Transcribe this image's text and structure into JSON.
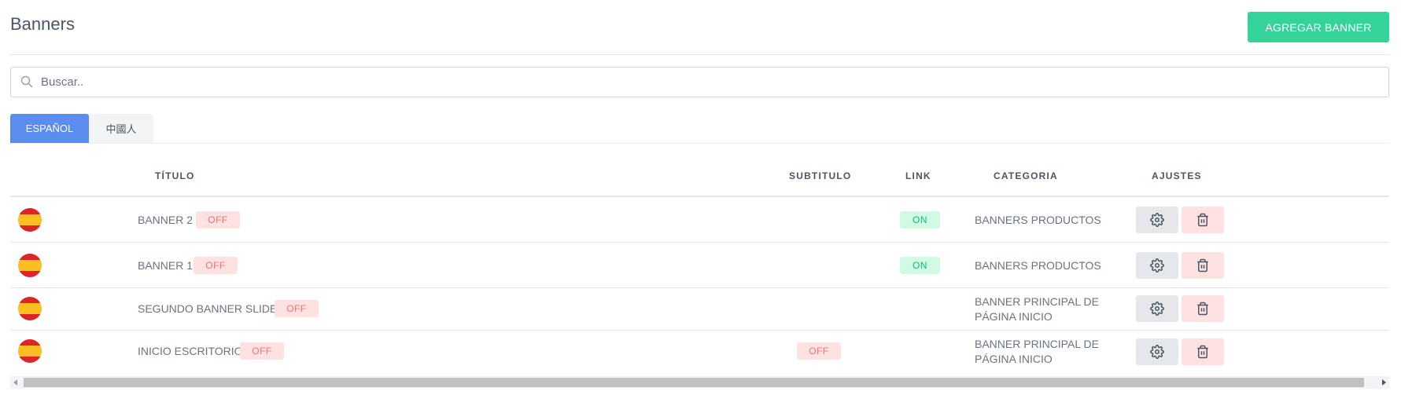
{
  "header": {
    "title": "Banners",
    "add_button": "AGREGAR BANNER"
  },
  "search": {
    "placeholder": "Buscar..",
    "value": "",
    "icon": "search-icon"
  },
  "tabs": [
    {
      "label": "ESPAÑOL",
      "active": true
    },
    {
      "label": "中國人",
      "active": false
    }
  ],
  "table": {
    "columns": {
      "titulo": "TÍTULO",
      "subtitulo": "SUBTITULO",
      "link": "LINK",
      "categoria": "CATEGORIA",
      "ajustes": "AJUSTES"
    },
    "rows": [
      {
        "flag": "spain-flag-icon",
        "titulo": "BANNER 2",
        "titulo_status": "OFF",
        "subtitulo_status": "",
        "link_status": "ON",
        "categoria_line1": "BANNERS PRODUCTOS",
        "categoria_line2": ""
      },
      {
        "flag": "spain-flag-icon",
        "titulo": "BANNER 1",
        "titulo_status": "OFF",
        "subtitulo_status": "",
        "link_status": "ON",
        "categoria_line1": "BANNERS PRODUCTOS",
        "categoria_line2": ""
      },
      {
        "flag": "spain-flag-icon",
        "titulo": "SEGUNDO BANNER SLIDE",
        "titulo_status": "OFF",
        "subtitulo_status": "",
        "link_status": "",
        "categoria_line1": "BANNER PRINCIPAL DE",
        "categoria_line2": "PÁGINA INICIO"
      },
      {
        "flag": "spain-flag-icon",
        "titulo": "INICIO ESCRITORIO",
        "titulo_status": "OFF",
        "subtitulo_status": "OFF",
        "link_status": "",
        "categoria_line1": "BANNER PRINCIPAL DE",
        "categoria_line2": "PÁGINA INICIO"
      }
    ]
  },
  "colors": {
    "accent_green": "#34d399",
    "tab_active": "#5b8def",
    "off_text": "#f87171",
    "off_bg": "#fee2e2",
    "on_text": "#10b981",
    "on_bg": "#d1fae5"
  }
}
